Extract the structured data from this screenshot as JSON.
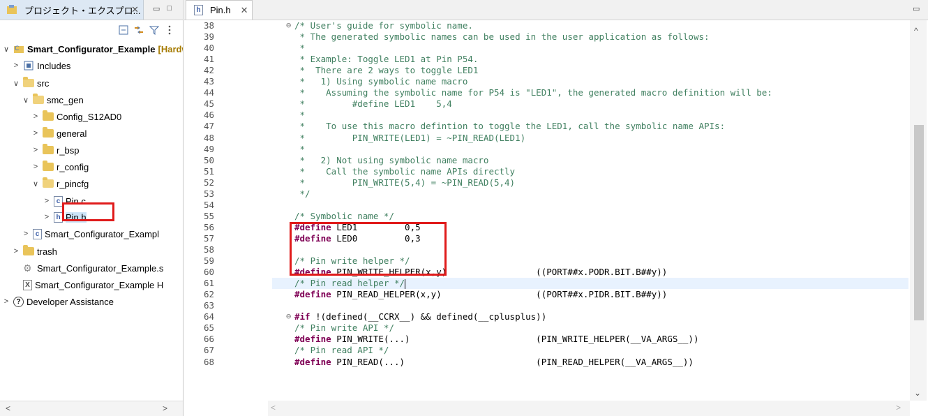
{
  "explorer": {
    "tab_title": "プロジェクト・エクスプロ...",
    "tab_close": "✕",
    "minimize": "▭",
    "maximize": "□",
    "tree": [
      {
        "arrow": "∨",
        "indent": 0,
        "icon": "project",
        "label": "Smart_Configurator_Example",
        "decor": "[HardwareDebug]",
        "bold": true
      },
      {
        "arrow": ">",
        "indent": 1,
        "icon": "includes",
        "label": "Includes"
      },
      {
        "arrow": "∨",
        "indent": 1,
        "icon": "folder-open",
        "label": "src"
      },
      {
        "arrow": "∨",
        "indent": 2,
        "icon": "folder-open",
        "label": "smc_gen"
      },
      {
        "arrow": ">",
        "indent": 3,
        "icon": "folder",
        "label": "Config_S12AD0"
      },
      {
        "arrow": ">",
        "indent": 3,
        "icon": "folder",
        "label": "general"
      },
      {
        "arrow": ">",
        "indent": 3,
        "icon": "folder",
        "label": "r_bsp"
      },
      {
        "arrow": ">",
        "indent": 3,
        "icon": "folder",
        "label": "r_config"
      },
      {
        "arrow": "∨",
        "indent": 3,
        "icon": "folder-open",
        "label": "r_pincfg"
      },
      {
        "arrow": ">",
        "indent": 4,
        "icon": "c-file",
        "label": "Pin.c"
      },
      {
        "arrow": ">",
        "indent": 4,
        "icon": "h-file",
        "label": "Pin.h",
        "selected": true
      },
      {
        "arrow": ">",
        "indent": 2,
        "icon": "c-file",
        "label": "Smart_Configurator_Exampl"
      },
      {
        "arrow": ">",
        "indent": 1,
        "icon": "folder",
        "label": "trash"
      },
      {
        "arrow": "",
        "indent": 1,
        "icon": "gear",
        "label": "Smart_Configurator_Example.s"
      },
      {
        "arrow": "",
        "indent": 1,
        "icon": "x-file",
        "label": "Smart_Configurator_Example H"
      },
      {
        "arrow": ">",
        "indent": 0,
        "icon": "help",
        "label": "Developer Assistance"
      }
    ]
  },
  "editor": {
    "tab_title": "Pin.h",
    "tab_close": "✕",
    "lines": [
      {
        "n": "38",
        "fold": "⊖",
        "parts": [
          [
            "comment",
            "/* User's guide for symbolic name."
          ]
        ]
      },
      {
        "n": "39",
        "parts": [
          [
            "comment",
            " * The generated symbolic names can be used in the user application as follows:"
          ]
        ]
      },
      {
        "n": "40",
        "parts": [
          [
            "comment",
            " *"
          ]
        ]
      },
      {
        "n": "41",
        "parts": [
          [
            "comment",
            " * Example: Toggle LED1 at Pin P54."
          ]
        ]
      },
      {
        "n": "42",
        "parts": [
          [
            "comment",
            " *  There are 2 ways to toggle LED1"
          ]
        ]
      },
      {
        "n": "43",
        "parts": [
          [
            "comment",
            " *   1) Using symbolic name macro"
          ]
        ]
      },
      {
        "n": "44",
        "parts": [
          [
            "comment",
            " *    Assuming the symbolic name for P54 is \"LED1\", the generated macro definition will be:"
          ]
        ]
      },
      {
        "n": "45",
        "parts": [
          [
            "comment",
            " *         #define LED1    5,4"
          ]
        ]
      },
      {
        "n": "46",
        "parts": [
          [
            "comment",
            " *"
          ]
        ]
      },
      {
        "n": "47",
        "parts": [
          [
            "comment",
            " *    To use this macro defintion to toggle the LED1, call the symbolic name APIs:"
          ]
        ]
      },
      {
        "n": "48",
        "parts": [
          [
            "comment",
            " *         PIN_WRITE(LED1) = ~PIN_READ(LED1)"
          ]
        ]
      },
      {
        "n": "49",
        "parts": [
          [
            "comment",
            " *"
          ]
        ]
      },
      {
        "n": "50",
        "parts": [
          [
            "comment",
            " *   2) Not using symbolic name macro"
          ]
        ]
      },
      {
        "n": "51",
        "parts": [
          [
            "comment",
            " *    Call the symbolic name APIs directly"
          ]
        ]
      },
      {
        "n": "52",
        "parts": [
          [
            "comment",
            " *         PIN_WRITE(5,4) = ~PIN_READ(5,4)"
          ]
        ]
      },
      {
        "n": "53",
        "parts": [
          [
            "comment",
            " */"
          ]
        ]
      },
      {
        "n": "54",
        "parts": []
      },
      {
        "n": "55",
        "parts": [
          [
            "comment",
            "/* Symbolic name */"
          ]
        ]
      },
      {
        "n": "56",
        "parts": [
          [
            "kw",
            "#define"
          ],
          [
            "plain",
            " LED1         0,5"
          ]
        ]
      },
      {
        "n": "57",
        "parts": [
          [
            "kw",
            "#define"
          ],
          [
            "plain",
            " LED0         0,3"
          ]
        ]
      },
      {
        "n": "58",
        "parts": []
      },
      {
        "n": "59",
        "parts": [
          [
            "comment",
            "/* Pin write helper */"
          ]
        ]
      },
      {
        "n": "60",
        "parts": [
          [
            "kw",
            "#define"
          ],
          [
            "plain",
            " PIN_WRITE_HELPER(x,y)                 ((PORT##x.PODR.BIT.B##y))"
          ]
        ]
      },
      {
        "n": "61",
        "current": true,
        "parts": [
          [
            "comment",
            "/* Pin read helper */"
          ]
        ]
      },
      {
        "n": "62",
        "parts": [
          [
            "kw",
            "#define"
          ],
          [
            "plain",
            " PIN_READ_HELPER(x,y)                  ((PORT##x.PIDR.BIT.B##y))"
          ]
        ]
      },
      {
        "n": "63",
        "parts": []
      },
      {
        "n": "64",
        "fold": "⊖",
        "parts": [
          [
            "kw",
            "#if"
          ],
          [
            "plain",
            " !(defined(__CCRX__) && defined(__cplusplus))"
          ]
        ]
      },
      {
        "n": "65",
        "parts": [
          [
            "comment",
            "/* Pin write API */"
          ]
        ]
      },
      {
        "n": "66",
        "parts": [
          [
            "kw",
            "#define"
          ],
          [
            "plain",
            " PIN_WRITE(...)                        (PIN_WRITE_HELPER(__VA_ARGS__))"
          ]
        ]
      },
      {
        "n": "67",
        "parts": [
          [
            "comment",
            "/* Pin read API */"
          ]
        ]
      },
      {
        "n": "68",
        "parts": [
          [
            "kw",
            "#define"
          ],
          [
            "plain",
            " PIN_READ(...)                         (PIN_READ_HELPER(__VA_ARGS__))"
          ]
        ]
      }
    ]
  },
  "scroll": {
    "up": "^",
    "down": "⌄",
    "left": "<",
    "right": ">"
  }
}
